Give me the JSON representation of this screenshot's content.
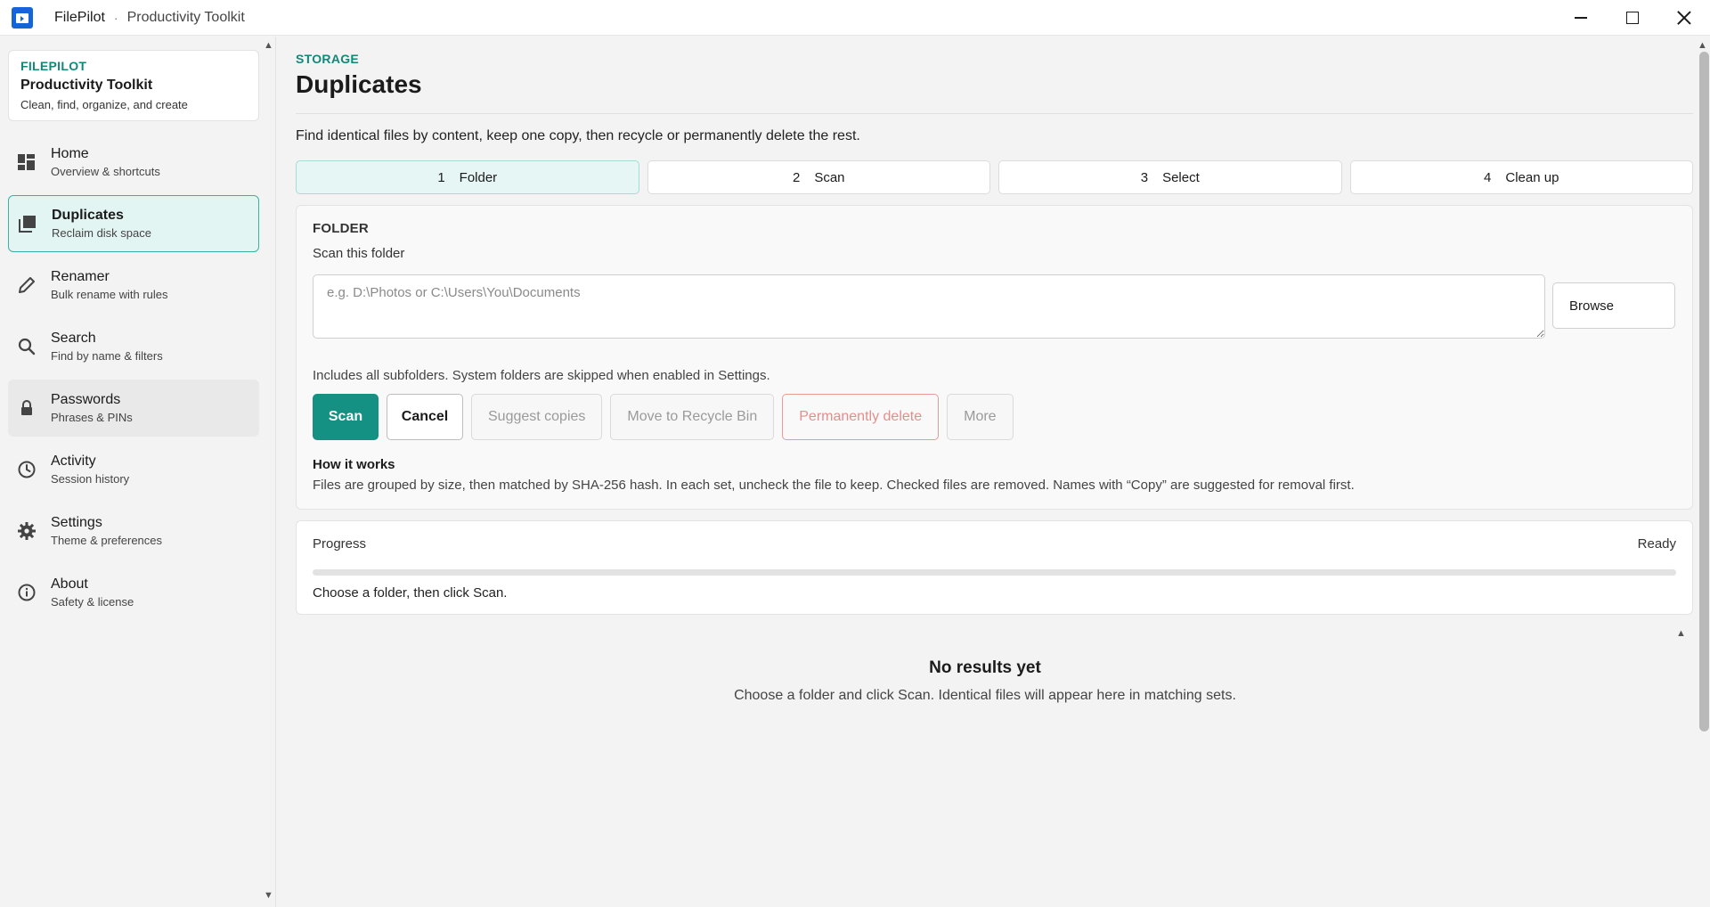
{
  "window": {
    "app_name": "FilePilot",
    "separator": "·",
    "subtitle": "Productivity Toolkit"
  },
  "sidebar": {
    "brand": {
      "kicker": "FILEPILOT",
      "title": "Productivity Toolkit",
      "description": "Clean, find, organize, and create"
    },
    "items": [
      {
        "label": "Home",
        "sub": "Overview & shortcuts",
        "icon": "dashboard-icon"
      },
      {
        "label": "Duplicates",
        "sub": "Reclaim disk space",
        "icon": "duplicates-icon",
        "active": true
      },
      {
        "label": "Renamer",
        "sub": "Bulk rename with rules",
        "icon": "pencil-icon"
      },
      {
        "label": "Search",
        "sub": "Find by name & filters",
        "icon": "search-icon"
      },
      {
        "label": "Passwords",
        "sub": "Phrases & PINs",
        "icon": "lock-icon",
        "hover": true
      },
      {
        "label": "Activity",
        "sub": "Session history",
        "icon": "clock-icon"
      },
      {
        "label": "Settings",
        "sub": "Theme & preferences",
        "icon": "gear-icon"
      },
      {
        "label": "About",
        "sub": "Safety & license",
        "icon": "info-icon"
      }
    ]
  },
  "main": {
    "breadcrumb": "STORAGE",
    "title": "Duplicates",
    "intro": "Find identical files by content, keep one copy, then recycle or permanently delete the rest.",
    "steps": [
      {
        "num": "1",
        "label": "Folder",
        "active": true
      },
      {
        "num": "2",
        "label": "Scan"
      },
      {
        "num": "3",
        "label": "Select"
      },
      {
        "num": "4",
        "label": "Clean up"
      }
    ],
    "folder": {
      "label": "FOLDER",
      "sublabel": "Scan this folder",
      "input_value": "",
      "input_placeholder": "e.g. D:\\Photos or C:\\Users\\You\\Documents",
      "browse_label": "Browse",
      "hint": "Includes all subfolders. System folders are skipped when enabled in Settings."
    },
    "actions": {
      "scan": "Scan",
      "cancel": "Cancel",
      "suggest": "Suggest copies",
      "recycle": "Move to Recycle Bin",
      "delete": "Permanently delete",
      "more": "More"
    },
    "how_it_works": {
      "title": "How it works",
      "text": "Files are grouped by size, then matched by SHA-256 hash. In each set, uncheck the file to keep. Checked files are removed. Names with “Copy” are suggested for removal first."
    },
    "progress": {
      "label": "Progress",
      "status": "Ready",
      "percent": 0,
      "message": "Choose a folder, then click Scan."
    },
    "empty_state": {
      "title": "No results yet",
      "text": "Choose a folder and click Scan. Identical files will appear here in matching sets."
    }
  },
  "colors": {
    "accent": "#159184",
    "accent_light": "#e2f5f3",
    "danger": "#e0908c",
    "titlebar_icon": "#1565d8"
  }
}
